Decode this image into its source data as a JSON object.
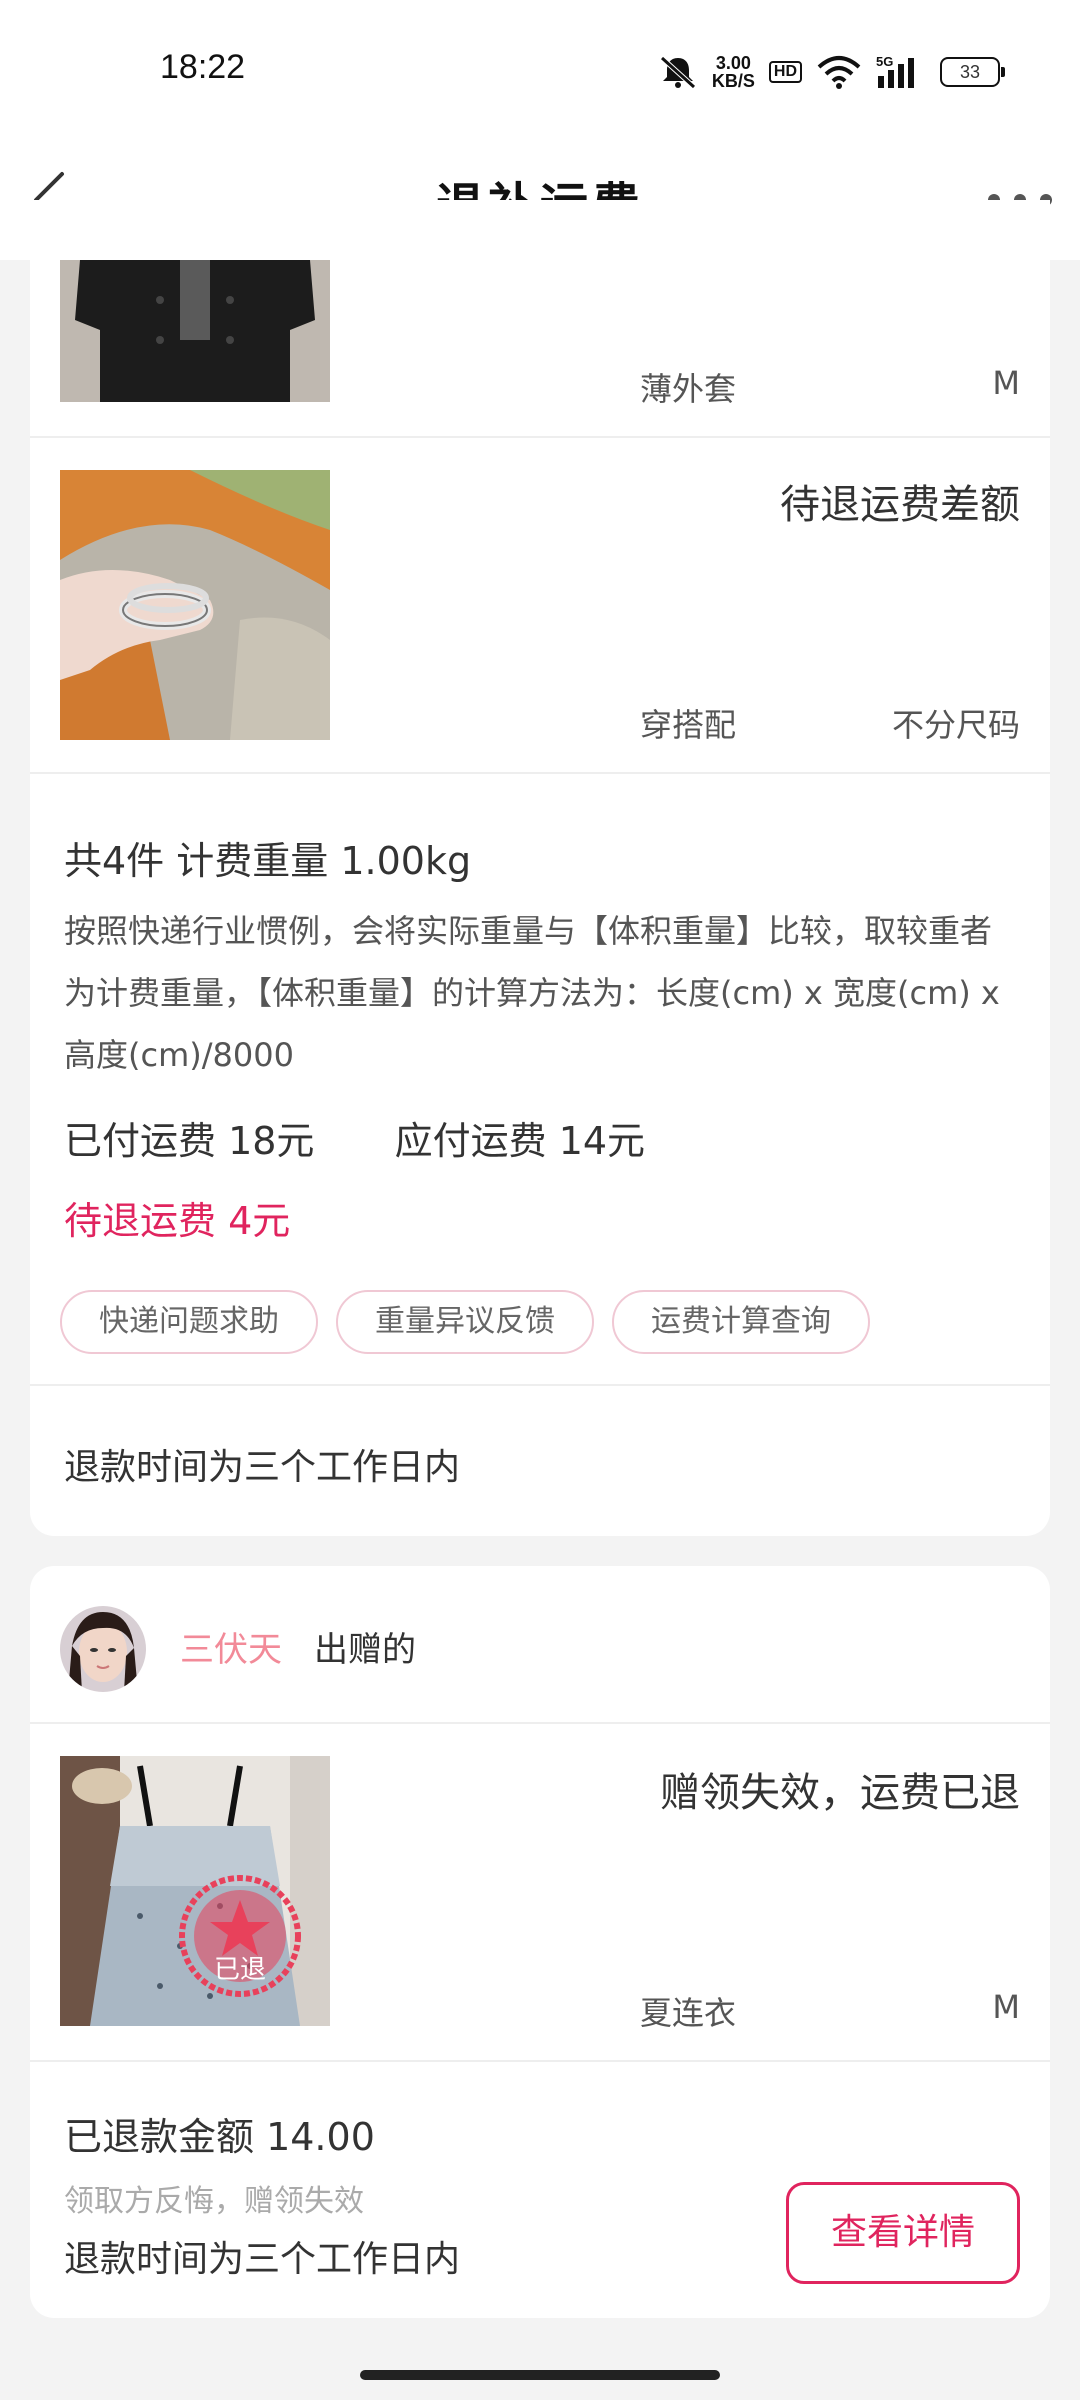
{
  "status_bar": {
    "time": "18:22",
    "net_speed_value": "3.00",
    "net_speed_unit": "KB/S",
    "hd_badge": "HD",
    "network": "5G",
    "battery": "33",
    "icons": [
      "mute-icon",
      "wifi-icon",
      "signal-icon",
      "battery-icon"
    ]
  },
  "nav": {
    "title": "退补运费",
    "back_icon": "chevron-left-icon",
    "more_icon": "more-dots-icon"
  },
  "order_card": {
    "items": [
      {
        "name": "薄外套",
        "size": "M",
        "status": "",
        "image": "black-jacket-photo"
      },
      {
        "name": "穿搭配",
        "size": "不分尺码",
        "status": "待退运费差额",
        "image": "ring-on-hand-photo"
      }
    ],
    "summary": "共4件 计费重量 1.00kg",
    "explanation": "按照快递行业惯例，会将实际重量与【体积重量】比较，取较重者为计费重量，【体积重量】的计算方法为：长度(cm) x 宽度(cm) x 高度(cm)/8000",
    "paid_shipping": "已付运费 18元",
    "due_shipping": "应付运费 14元",
    "pending_refund": "待退运费 4元",
    "chips": [
      "快递问题求助",
      "重量异议反馈",
      "运费计算查询"
    ],
    "refund_time": "退款时间为三个工作日内"
  },
  "gift_card": {
    "gifter_name": "三伏天",
    "gift_text": "出赠的",
    "item": {
      "name": "夏连衣",
      "size": "M",
      "status": "赠领失效，运费已退",
      "image": "dress-photo",
      "stamp": "已退"
    },
    "refund_amount": "已退款金额 14.00",
    "regret_text": "领取方反悔，赠领失效",
    "refund_time": "退款时间为三个工作日内",
    "detail_button": "查看详情"
  },
  "colors": {
    "accent": "#e0245e",
    "gifter": "#f28a98",
    "background": "#f3f3f3"
  }
}
